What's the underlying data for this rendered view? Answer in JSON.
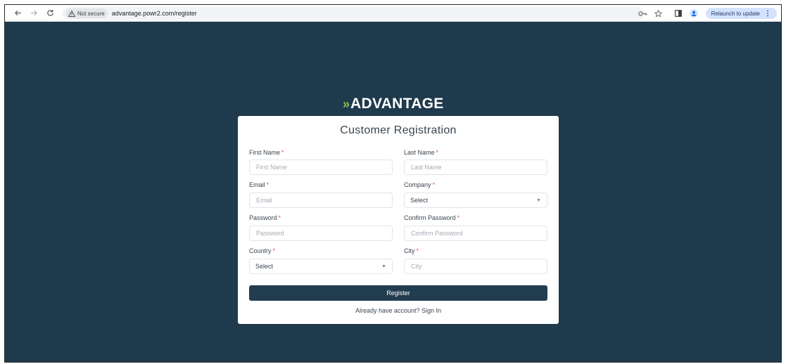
{
  "browser": {
    "security_label": "Not secure",
    "url": "advantage.powr2.com/register",
    "relaunch_label": "Relaunch to update"
  },
  "logo": {
    "chevron": "»",
    "text": "ADVANTAGE"
  },
  "form": {
    "title": "Customer Registration",
    "required_marker": "*",
    "first_name": {
      "label": "First Name",
      "placeholder": "First Name"
    },
    "last_name": {
      "label": "Last Name",
      "placeholder": "Last Name"
    },
    "email": {
      "label": "Email",
      "placeholder": "Email"
    },
    "company": {
      "label": "Company",
      "value": "Select"
    },
    "password": {
      "label": "Password",
      "placeholder": "Password"
    },
    "confirm_password": {
      "label": "Confirm Password",
      "placeholder": "Confirm Password"
    },
    "country": {
      "label": "Country",
      "value": "Select"
    },
    "city": {
      "label": "City",
      "placeholder": "City"
    },
    "register_label": "Register",
    "signin_prompt": "Already have account?",
    "signin_link": "Sign In"
  },
  "colors": {
    "page_background": "#1f3a4d",
    "button": "#223d50",
    "logo_accent": "#8bc34a",
    "required": "#e05252"
  }
}
